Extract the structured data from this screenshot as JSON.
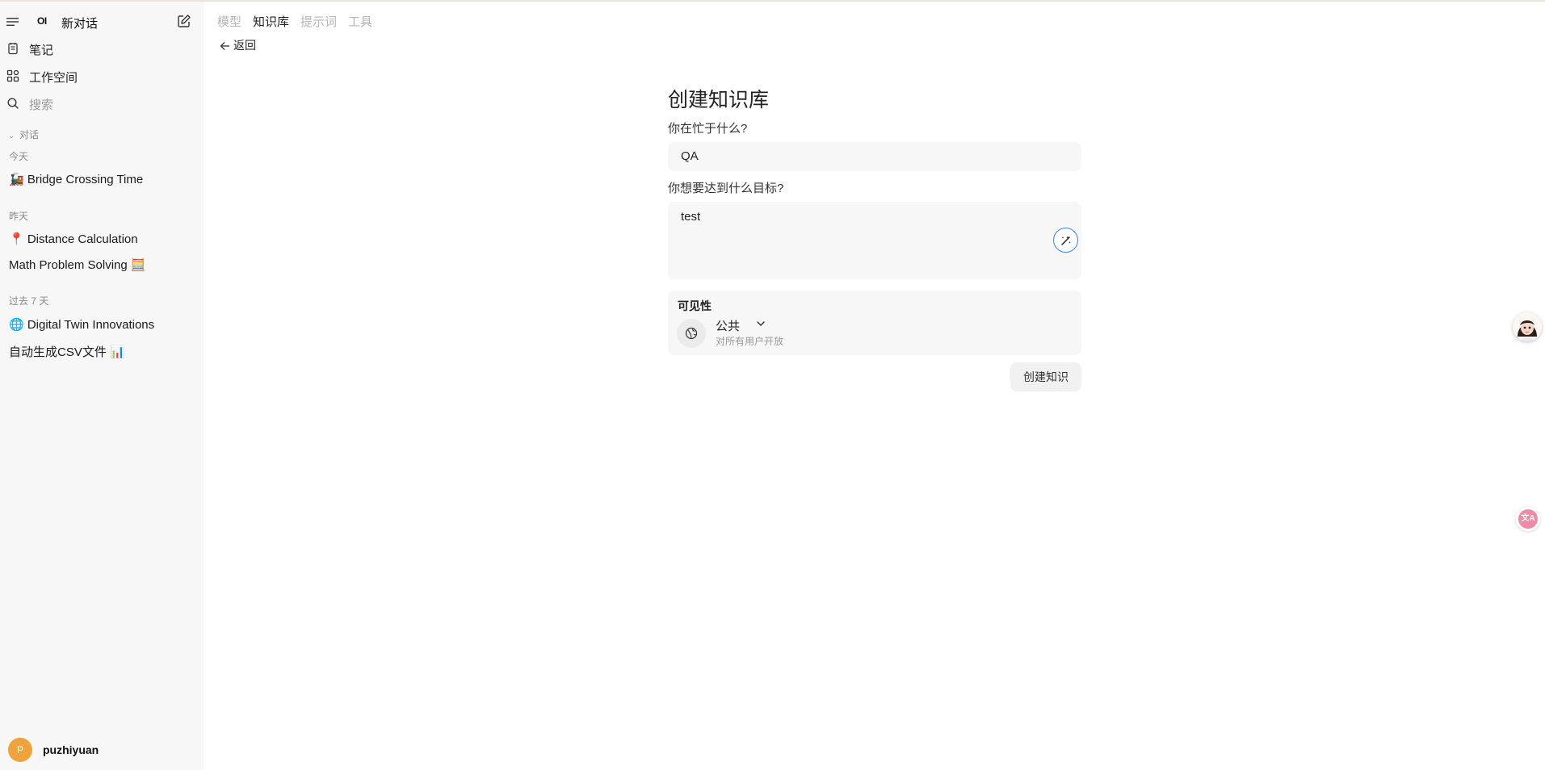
{
  "sidebar": {
    "logo": "OI",
    "new_chat_label": "新对话",
    "nav": {
      "notes": "笔记",
      "workspace": "工作空间",
      "search_placeholder": "搜索"
    },
    "section_label": "对话",
    "groups": [
      {
        "label": "今天",
        "items": [
          "🚂 Bridge Crossing Time"
        ]
      },
      {
        "label": "昨天",
        "items": [
          "📍 Distance Calculation",
          "Math Problem Solving 🧮"
        ]
      },
      {
        "label": "过去 7 天",
        "items": [
          "🌐 Digital Twin Innovations",
          "自动生成CSV文件 📊"
        ]
      }
    ],
    "user": {
      "initial": "P",
      "name": "puzhiyuan"
    }
  },
  "tabs": [
    "模型",
    "知识库",
    "提示词",
    "工具"
  ],
  "active_tab": "知识库",
  "back_label": "返回",
  "form": {
    "title": "创建知识库",
    "name_question": "你在忙于什么?",
    "name_value": "QA",
    "goal_question": "你想要达到什么目标?",
    "goal_value": "test",
    "visibility": {
      "title": "可见性",
      "value": "公共",
      "description": "对所有用户开放"
    },
    "submit_label": "创建知识"
  },
  "floating": {
    "translate_glyph": "文A"
  },
  "colors": {
    "sidebar_bg": "#f7f7f7",
    "accent": "#3b82f6",
    "avatar_bg": "#f0a33a",
    "translate_bg": "#f08aa6"
  }
}
